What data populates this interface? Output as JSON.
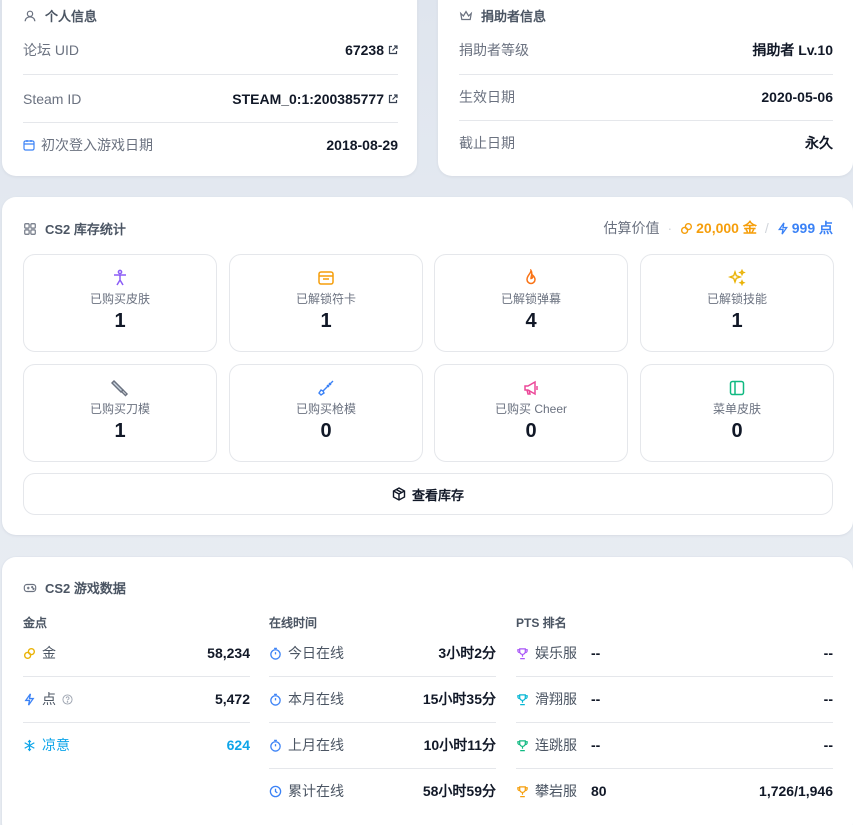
{
  "personal": {
    "title": "个人信息",
    "rows": [
      {
        "label": "论坛 UID",
        "value": "67238"
      },
      {
        "label": "Steam ID",
        "value": "STEAM_0:1:200385777"
      },
      {
        "label": "初次登入游戏日期",
        "value": "2018-08-29"
      }
    ]
  },
  "donor": {
    "title": "捐助者信息",
    "rows": [
      {
        "label": "捐助者等级",
        "value": "捐助者 Lv.10"
      },
      {
        "label": "生效日期",
        "value": "2020-05-06"
      },
      {
        "label": "截止日期",
        "value": "永久"
      }
    ]
  },
  "inventory": {
    "title": "CS2 库存统计",
    "estimate_label": "估算价值",
    "gold_value": "20,000 金",
    "separator": "/",
    "points_value": "999 点",
    "stats": [
      {
        "label": "已购买皮肤",
        "value": "1",
        "icon": "person-icon",
        "color": "#8b5cf6"
      },
      {
        "label": "已解锁符卡",
        "value": "1",
        "icon": "card-icon",
        "color": "#f59e0b"
      },
      {
        "label": "已解锁弹幕",
        "value": "4",
        "icon": "flame-icon",
        "color": "#f97316"
      },
      {
        "label": "已解锁技能",
        "value": "1",
        "icon": "sparkles-icon",
        "color": "#eab308"
      },
      {
        "label": "已购买刀模",
        "value": "1",
        "icon": "knife-icon",
        "color": "#6b7280"
      },
      {
        "label": "已购买枪模",
        "value": "0",
        "icon": "rifle-icon",
        "color": "#3b82f6"
      },
      {
        "label": "已购买 Cheer",
        "value": "0",
        "icon": "megaphone-icon",
        "color": "#ec4899"
      },
      {
        "label": "菜单皮肤",
        "value": "0",
        "icon": "panel-icon",
        "color": "#10b981"
      }
    ],
    "view_button": "查看库存"
  },
  "game": {
    "title": "CS2 游戏数据",
    "gold_col": {
      "header": "金点",
      "rows": [
        {
          "label": "金",
          "value": "58,234"
        },
        {
          "label": "点",
          "value": "5,472"
        },
        {
          "label": "凉意",
          "value": "624"
        }
      ]
    },
    "online_col": {
      "header": "在线时间",
      "rows": [
        {
          "label": "今日在线",
          "value": "3小时2分"
        },
        {
          "label": "本月在线",
          "value": "15小时35分"
        },
        {
          "label": "上月在线",
          "value": "10小时11分"
        },
        {
          "label": "累计在线",
          "value": "58小时59分"
        }
      ]
    },
    "pts_col": {
      "header": "PTS 排名",
      "rows": [
        {
          "label": "娱乐服",
          "rank": "--",
          "score": "--",
          "color": "#a855f7"
        },
        {
          "label": "滑翔服",
          "rank": "--",
          "score": "--",
          "color": "#06b6d4"
        },
        {
          "label": "连跳服",
          "rank": "--",
          "score": "--",
          "color": "#10b981"
        },
        {
          "label": "攀岩服",
          "rank": "80",
          "score": "1,726/1,946",
          "color": "#f59e0b"
        }
      ]
    }
  }
}
